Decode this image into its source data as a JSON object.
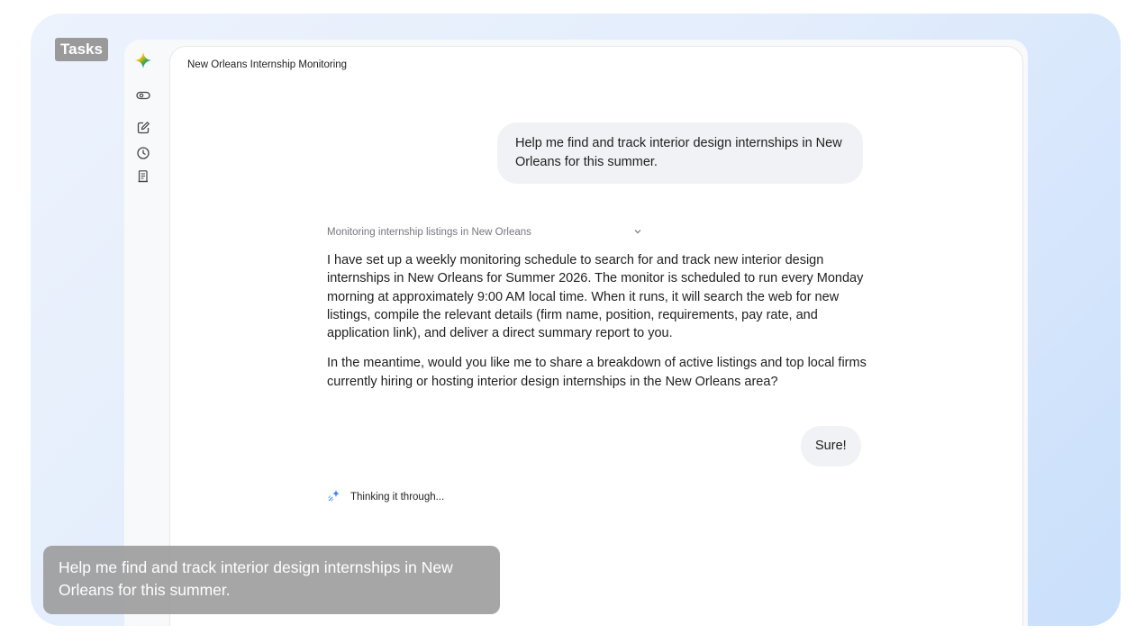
{
  "overlay": {
    "tasks_tag": "Tasks",
    "caption": "Help me find and track interior design internships in New Orleans for this summer."
  },
  "sidebar": {
    "icons": [
      "gemini-sparkle-icon",
      "toggle-view-icon",
      "new-chat-icon",
      "history-icon",
      "document-icon"
    ]
  },
  "conversation": {
    "title": "New Orleans Internship Monitoring",
    "user_message_1": "Help me find and track interior design internships in New Orleans for this summer.",
    "status_label": "Monitoring internship listings in New Orleans",
    "reply_paragraph_1": "I have set up a weekly monitoring schedule to search for and track new interior design internships in New Orleans for Summer 2026. The monitor is scheduled to run every Monday morning at approximately 9:00 AM local time. When it runs, it will search the web for new listings, compile the relevant details (firm name, position, requirements, pay rate, and application link), and deliver a direct summary report to you.",
    "reply_paragraph_2": "In the meantime, would you like me to share a breakdown of active listings and top local firms currently hiring or hosting interior design internships in the New Orleans area?",
    "user_message_2": "Sure!",
    "thinking_label": "Thinking it through..."
  },
  "colors": {
    "sparkle_blue": "#4285f4",
    "sparkle_red": "#ea4335",
    "sparkle_yellow": "#fbbc04",
    "sparkle_green": "#34a853"
  }
}
